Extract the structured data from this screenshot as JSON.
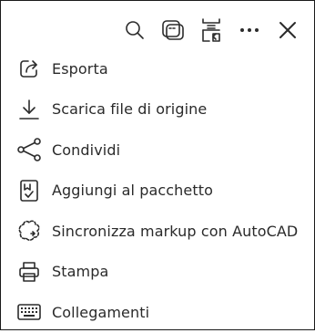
{
  "toolbar": {
    "buttons": [
      {
        "icon": "search-icon"
      },
      {
        "icon": "layers-icon"
      },
      {
        "icon": "split-view-icon"
      },
      {
        "icon": "more-options-icon"
      },
      {
        "icon": "close-icon"
      }
    ]
  },
  "menu": {
    "items": [
      {
        "label": "Esporta",
        "icon": "export-icon"
      },
      {
        "label": "Scarica file di origine",
        "icon": "download-icon"
      },
      {
        "label": "Condividi",
        "icon": "share-icon"
      },
      {
        "label": "Aggiungi al pacchetto",
        "icon": "add-to-package-icon"
      },
      {
        "label": "Sincronizza markup con AutoCAD",
        "icon": "sync-markup-icon"
      },
      {
        "label": "Stampa",
        "icon": "print-icon"
      },
      {
        "label": "Collegamenti",
        "icon": "keyboard-icon"
      }
    ]
  }
}
